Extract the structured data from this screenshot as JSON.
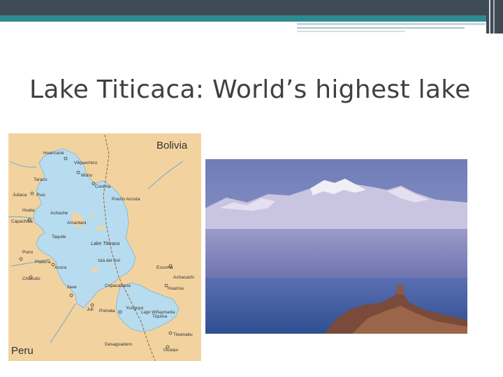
{
  "slide": {
    "title": "Lake Titicaca: World’s highest lake"
  },
  "map": {
    "country_bolivia": "Bolivia",
    "country_peru": "Peru",
    "lake_label": "Lake Titicaca",
    "lake_small_label": "Lago Wiñaymarka",
    "places": [
      "Huancané",
      "Vilquechico",
      "Moho",
      "Conima",
      "Puerto Acosta",
      "Taraco",
      "Pusi",
      "Achache",
      "Juliaca",
      "Huata",
      "Capachica",
      "Amantani",
      "Taquile",
      "Puno",
      "Platería",
      "Acora",
      "Chucuito",
      "Ilave",
      "Juli",
      "Pomata",
      "Yunguyo",
      "Copacabana",
      "Isla del Sol",
      "Escoma",
      "Huarina",
      "Tiquina",
      "Desaguadero",
      "Guaqui",
      "Tiwanaku",
      "Achacachi",
      "Coata",
      "Puerto Acosta"
    ],
    "colors": {
      "land": "#f2d3a0",
      "lake": "#b8dcef",
      "river": "#6fa8c9",
      "border": "#8a6a4a"
    }
  },
  "photo": {
    "alt": "Snow-capped Cordillera Real over Lake Titicaca",
    "colors": {
      "sky": "#8f96c4",
      "mountains": "#d9d6ea",
      "haze": "#7f85b8",
      "water": "#3f5a9c",
      "shore": "#7a4a3a"
    }
  }
}
